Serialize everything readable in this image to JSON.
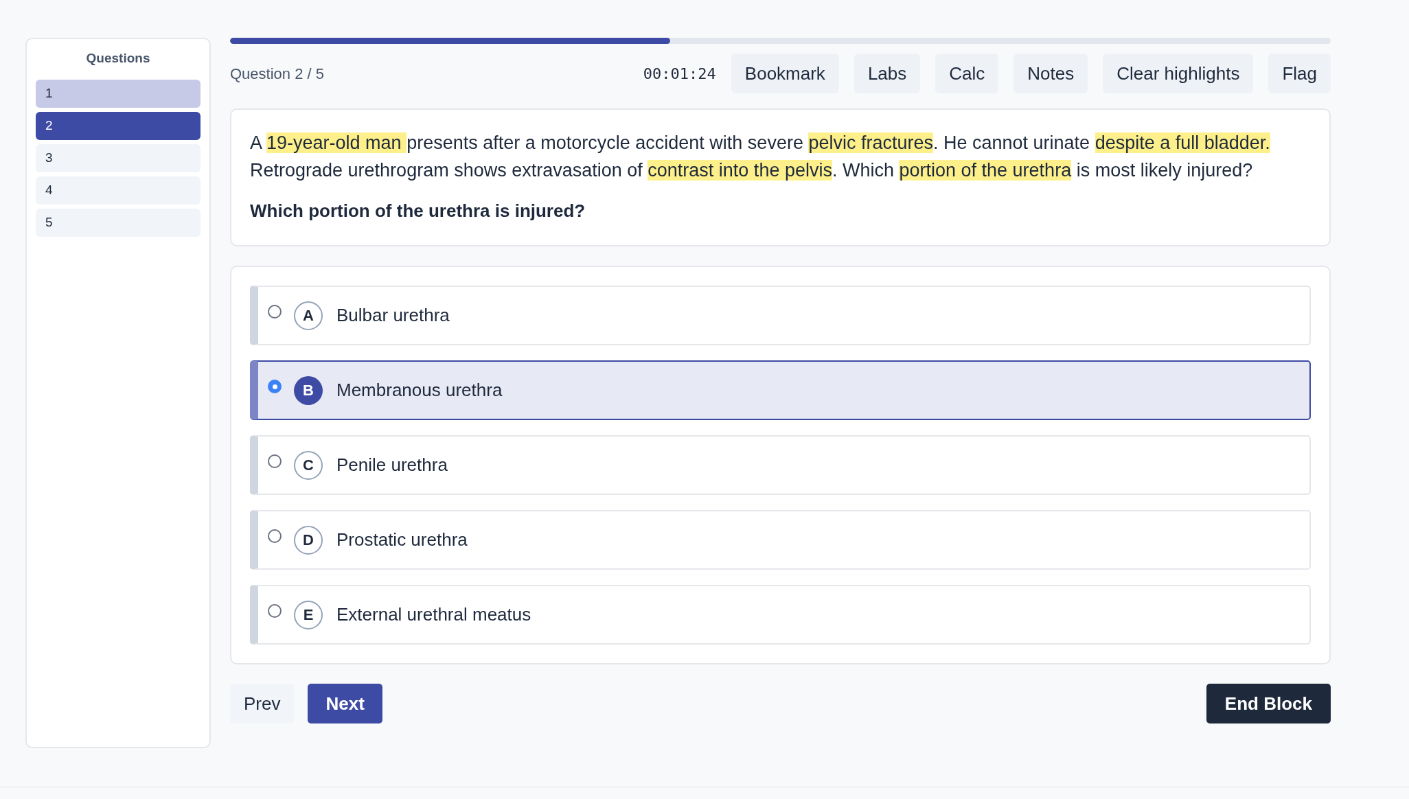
{
  "sidebar": {
    "title": "Questions",
    "items": [
      {
        "label": "1",
        "selected": false,
        "answered": true
      },
      {
        "label": "2",
        "selected": true
      },
      {
        "label": "3",
        "selected": false,
        "answered": false
      },
      {
        "label": "4",
        "selected": false,
        "answered": false
      },
      {
        "label": "5",
        "selected": false,
        "answered": false
      }
    ]
  },
  "progress": {
    "level": 0.4
  },
  "toolbar": {
    "counter": "Question 2 / 5",
    "timer": "00:01:24",
    "buttons": [
      "Bookmark",
      "Labs",
      "Calc",
      "Notes",
      "Clear highlights",
      "Flag"
    ]
  },
  "question": {
    "passage": [
      {
        "text": "A ",
        "highlighted": false
      },
      {
        "text": "19-year-old man ",
        "highlighted": true
      },
      {
        "text": "presents after a motorcycle accident with severe ",
        "highlighted": false
      },
      {
        "text": "pelvic fractures",
        "highlighted": true
      },
      {
        "text": ". He cannot urinate ",
        "highlighted": false
      },
      {
        "text": "despite a full bladder.",
        "highlighted": true
      },
      {
        "text": " Retrograde urethrogram shows extravasation of ",
        "highlighted": false
      },
      {
        "text": "contrast into the pelvis",
        "highlighted": true
      },
      {
        "text": ". Which ",
        "highlighted": false
      },
      {
        "text": "portion of the urethra",
        "highlighted": true
      },
      {
        "text": " is most likely injured?",
        "highlighted": false
      }
    ],
    "prompt": "Which portion of the urethra is injured?"
  },
  "options": [
    {
      "letter": "A",
      "text": "Bulbar urethra",
      "selected": false
    },
    {
      "letter": "B",
      "text": "Membranous urethra",
      "selected": true
    },
    {
      "letter": "C",
      "text": "Penile urethra",
      "selected": false
    },
    {
      "letter": "D",
      "text": "Prostatic urethra",
      "selected": false
    },
    {
      "letter": "E",
      "text": "External urethral meatus",
      "selected": false
    }
  ],
  "footer": {
    "prev": "Prev",
    "next": "Next",
    "end": "End Block"
  }
}
